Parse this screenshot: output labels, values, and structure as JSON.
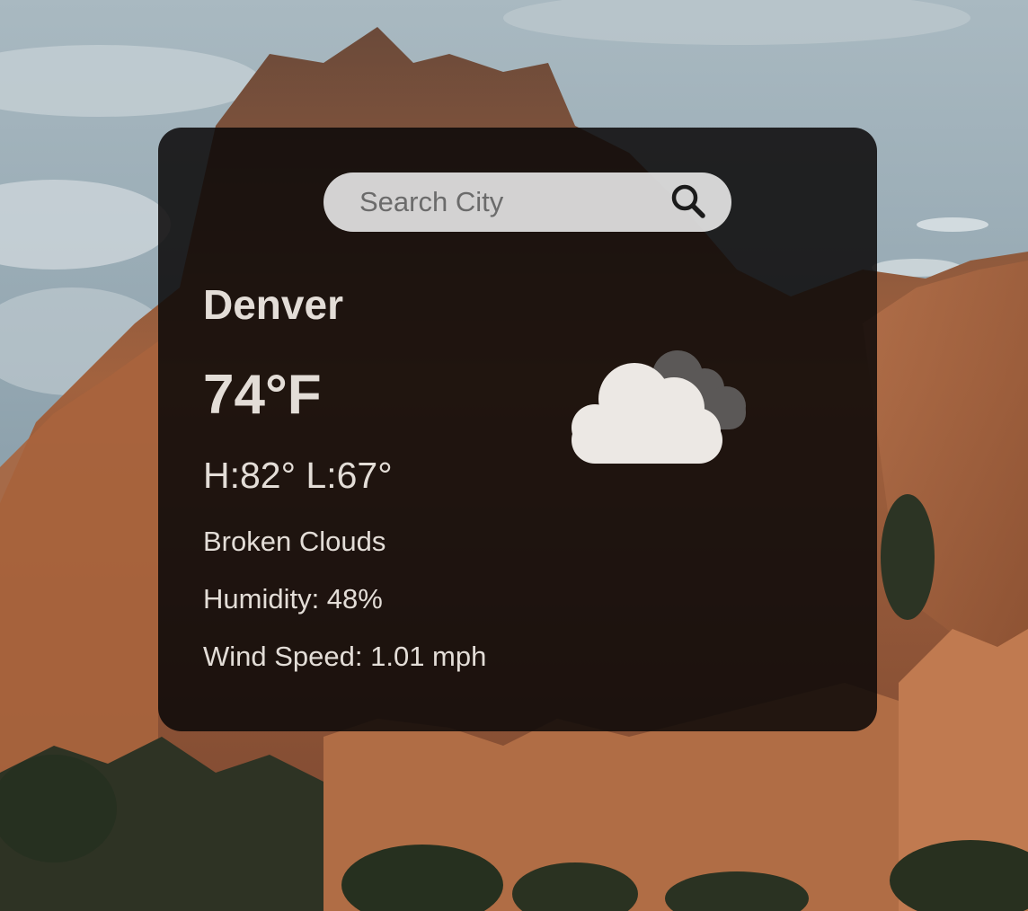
{
  "search": {
    "placeholder": "Search City",
    "value": ""
  },
  "weather": {
    "city": "Denver",
    "temperature": "74°F",
    "high_low": "H:82° L:67°",
    "description": "Broken Clouds",
    "humidity": "Humidity: 48%",
    "wind_speed": "Wind Speed: 1.01 mph",
    "icon": "broken-clouds-icon"
  },
  "colors": {
    "card_background": "#0a0808",
    "text": "#e3ddd7",
    "search_background": "#e8e8e8"
  }
}
